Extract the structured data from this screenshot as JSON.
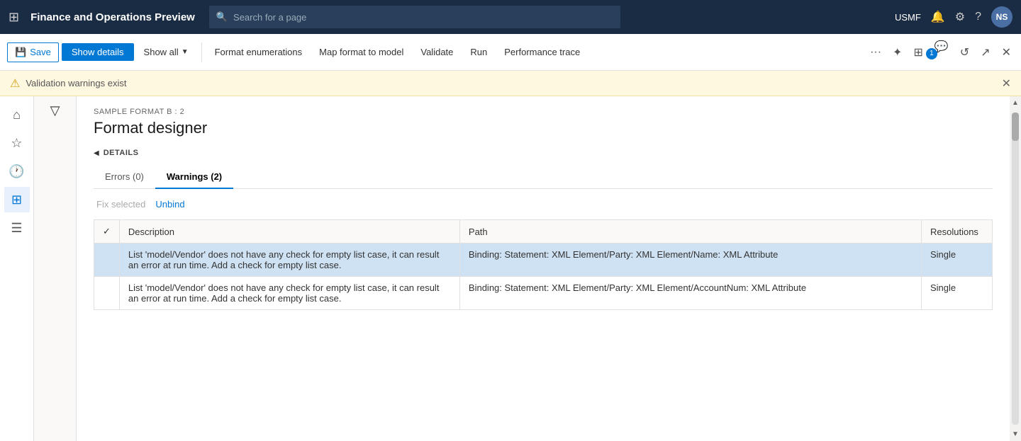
{
  "app": {
    "title": "Finance and Operations Preview",
    "org": "USMF",
    "avatar": "NS"
  },
  "search": {
    "placeholder": "Search for a page"
  },
  "toolbar": {
    "save_label": "Save",
    "show_details_label": "Show details",
    "show_all_label": "Show all",
    "format_enumerations_label": "Format enumerations",
    "map_format_label": "Map format to model",
    "validate_label": "Validate",
    "run_label": "Run",
    "performance_trace_label": "Performance trace",
    "badge_count": "1"
  },
  "warning": {
    "text": "Validation warnings exist"
  },
  "page": {
    "subtitle": "SAMPLE FORMAT B : 2",
    "title": "Format designer"
  },
  "details": {
    "label": "DETAILS"
  },
  "tabs": [
    {
      "label": "Errors (0)",
      "active": false
    },
    {
      "label": "Warnings (2)",
      "active": true
    }
  ],
  "actions": {
    "fix_selected": "Fix selected",
    "unbind": "Unbind"
  },
  "table": {
    "columns": [
      "",
      "Description",
      "Path",
      "Resolutions"
    ],
    "rows": [
      {
        "selected": true,
        "description": "List 'model/Vendor' does not have any check for empty list case, it can result an error at run time. Add a check for empty list case.",
        "path": "Binding: Statement: XML Element/Party: XML Element/Name: XML Attribute",
        "resolution": "Single"
      },
      {
        "selected": false,
        "description": "List 'model/Vendor' does not have any check for empty list case, it can result an error at run time. Add a check for empty list case.",
        "path": "Binding: Statement: XML Element/Party: XML Element/AccountNum: XML Attribute",
        "resolution": "Single"
      }
    ]
  }
}
